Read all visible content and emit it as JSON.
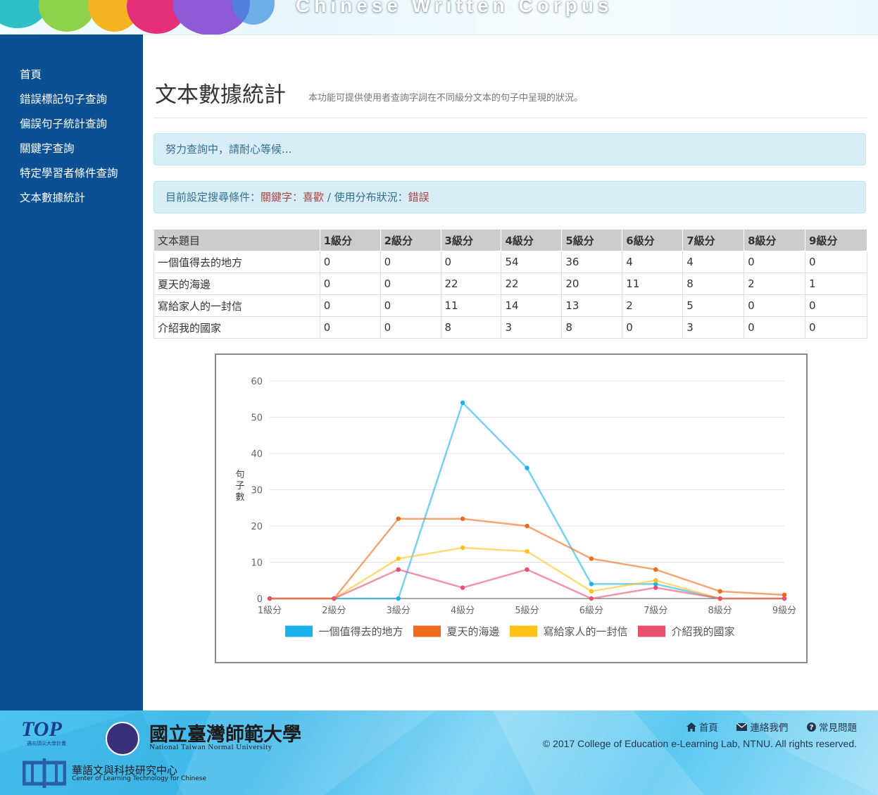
{
  "header": {
    "banner_title": "Chinese Written Corpus"
  },
  "sidebar": {
    "items": [
      {
        "label": "首頁"
      },
      {
        "label": "錯誤標記句子查詢"
      },
      {
        "label": "偏誤句子統計查詢"
      },
      {
        "label": "關鍵字查詢"
      },
      {
        "label": "特定學習者條件查詢"
      },
      {
        "label": "文本數據統計"
      }
    ]
  },
  "main": {
    "title": "文本數據統計",
    "subtitle": "本功能可提供使用者查詢字詞在不同級分文本的句子中呈現的狀況。",
    "loading_message": "努力查詢中，請耐心等候...",
    "criteria": {
      "prefix": "目前設定搜尋條件：",
      "keyword_label": "關鍵字：",
      "keyword": "喜歡",
      "separator": " / ",
      "usage_label": "使用分布狀況：",
      "usage": "錯誤"
    },
    "table": {
      "headers": [
        "文本題目",
        "1級分",
        "2級分",
        "3級分",
        "4級分",
        "5級分",
        "6級分",
        "7級分",
        "8級分",
        "9級分"
      ],
      "rows": [
        [
          "一個值得去的地方",
          "0",
          "0",
          "0",
          "54",
          "36",
          "4",
          "4",
          "0",
          "0"
        ],
        [
          "夏天的海邊",
          "0",
          "0",
          "22",
          "22",
          "20",
          "11",
          "8",
          "2",
          "1"
        ],
        [
          "寫給家人的一封信",
          "0",
          "0",
          "11",
          "14",
          "13",
          "2",
          "5",
          "0",
          "0"
        ],
        [
          "介紹我的國家",
          "0",
          "0",
          "8",
          "3",
          "8",
          "0",
          "3",
          "0",
          "0"
        ]
      ]
    }
  },
  "chart_data": {
    "type": "line",
    "title": "",
    "xlabel": "",
    "ylabel": "句子數",
    "ylim": [
      0,
      60
    ],
    "yticks": [
      0,
      10,
      20,
      30,
      40,
      50,
      60
    ],
    "categories": [
      "1級分",
      "2級分",
      "3級分",
      "4級分",
      "5級分",
      "6級分",
      "7級分",
      "8級分",
      "9級分"
    ],
    "legend_position": "bottom",
    "grid": true,
    "series": [
      {
        "name": "一個值得去的地方",
        "color": "#1bb3ea",
        "values": [
          0,
          0,
          0,
          54,
          36,
          4,
          4,
          0,
          0
        ]
      },
      {
        "name": "夏天的海邊",
        "color": "#ee6a1c",
        "values": [
          0,
          0,
          22,
          22,
          20,
          11,
          8,
          2,
          1
        ]
      },
      {
        "name": "寫給家人的一封信",
        "color": "#ffc21a",
        "values": [
          0,
          0,
          11,
          14,
          13,
          2,
          5,
          0,
          0
        ]
      },
      {
        "name": "介紹我的國家",
        "color": "#e8506e",
        "values": [
          0,
          0,
          8,
          3,
          8,
          0,
          3,
          0,
          0
        ]
      }
    ]
  },
  "footer": {
    "links": [
      {
        "label": "首頁",
        "icon": "home-icon"
      },
      {
        "label": "連絡我們",
        "icon": "envelope-icon"
      },
      {
        "label": "常見問題",
        "icon": "question-circle-icon"
      }
    ],
    "copyright": "© 2017 College of Education e-Learning Lab, NTNU. All rights reserved.",
    "top_logo_text": "TOP",
    "top_logo_caption": "邁向頂尖大學計畫",
    "ntnu_name_cn": "國立臺灣師範大學",
    "ntnu_name_en": "National Taiwan Normal University",
    "cltc_name_cn": "華語文與科技研究中心",
    "cltc_name_en": "Center of Learning Technology for Chinese"
  }
}
